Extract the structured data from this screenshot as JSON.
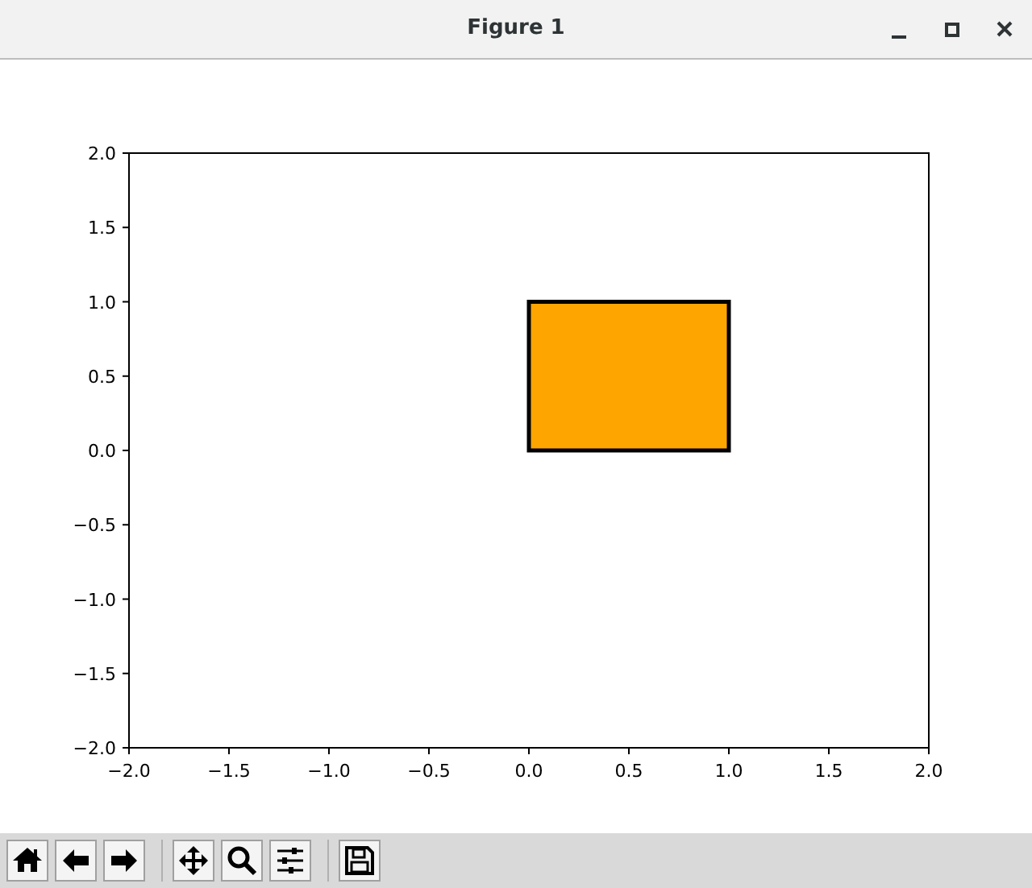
{
  "window": {
    "title": "Figure 1"
  },
  "figure": {
    "chart_data": {
      "type": "bar",
      "x": [
        0.5
      ],
      "series": [
        {
          "color": "#ffa500",
          "values": [
            1
          ]
        }
      ],
      "xlim": [
        -2,
        2
      ],
      "ylim": [
        -2,
        2
      ],
      "xticks": [
        {
          "value": -2,
          "label": "−2.0"
        },
        {
          "value": -1.5,
          "label": "−1.5"
        },
        {
          "value": -1,
          "label": "−1.0"
        },
        {
          "value": -0.5,
          "label": "−0.5"
        },
        {
          "value": 0,
          "label": "0.0"
        },
        {
          "value": 0.5,
          "label": "0.5"
        },
        {
          "value": 1,
          "label": "1.0"
        },
        {
          "value": 1.5,
          "label": "1.5"
        },
        {
          "value": 2,
          "label": "2.0"
        }
      ],
      "yticks": [
        {
          "value": -2,
          "label": "−2.0"
        },
        {
          "value": -1.5,
          "label": "−1.5"
        },
        {
          "value": -1,
          "label": "−1.0"
        },
        {
          "value": -0.5,
          "label": "−0.5"
        },
        {
          "value": 0,
          "label": "0.0"
        },
        {
          "value": 0.5,
          "label": "0.5"
        },
        {
          "value": 1,
          "label": "1.0"
        },
        {
          "value": 1.5,
          "label": "1.5"
        },
        {
          "value": 2,
          "label": "2.0"
        }
      ]
    }
  },
  "toolbar": {
    "groups": [
      [
        {
          "kind": "home"
        },
        {
          "kind": "back"
        },
        {
          "kind": "forward"
        }
      ],
      [
        {
          "kind": "pan"
        },
        {
          "kind": "zoom"
        },
        {
          "kind": "configure"
        }
      ],
      [
        {
          "kind": "save"
        }
      ]
    ]
  }
}
